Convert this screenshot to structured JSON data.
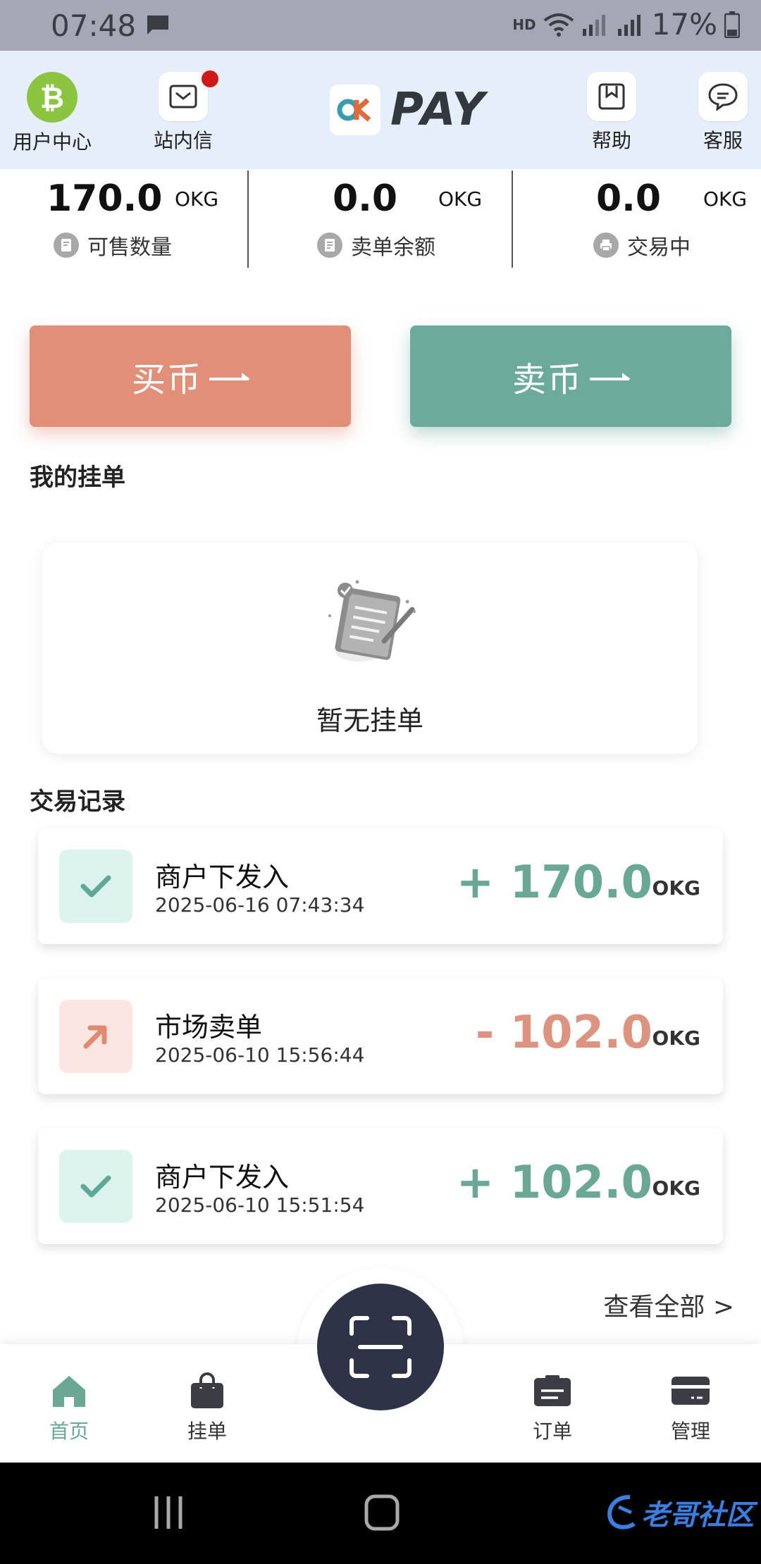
{
  "status_bar": {
    "time": "07:48",
    "network": "HD",
    "battery": "17%"
  },
  "header": {
    "user_center": "用户中心",
    "messages": "站内信",
    "logo_text": "PAY",
    "help": "帮助",
    "service": "客服"
  },
  "stats": [
    {
      "value": "170.0",
      "unit": "OKG",
      "label": "可售数量"
    },
    {
      "value": "0.0",
      "unit": "OKG",
      "label": "卖单余额"
    },
    {
      "value": "0.0",
      "unit": "OKG",
      "label": "交易中"
    }
  ],
  "actions": {
    "buy": "买币",
    "sell": "卖币"
  },
  "my_orders": {
    "title": "我的挂单",
    "empty_text": "暂无挂单"
  },
  "records": {
    "title": "交易记录",
    "items": [
      {
        "title": "商户下发入",
        "date": "2025-06-16 07:43:34",
        "amount": "+ 170.0",
        "unit": "OKG",
        "type": "in"
      },
      {
        "title": "市场卖单",
        "date": "2025-06-10 15:56:44",
        "amount": "- 102.0",
        "unit": "OKG",
        "type": "out"
      },
      {
        "title": "商户下发入",
        "date": "2025-06-10 15:51:54",
        "amount": "+ 102.0",
        "unit": "OKG",
        "type": "in"
      }
    ],
    "view_all": "查看全部 >"
  },
  "bottom_nav": {
    "home": "首页",
    "orders_list": "挂单",
    "orders": "订单",
    "manage": "管理"
  },
  "watermark": "老哥社区",
  "colors": {
    "buy": "#e28f7a",
    "sell": "#6cab9b",
    "accent": "#6aa797",
    "scan": "#2e3347"
  }
}
